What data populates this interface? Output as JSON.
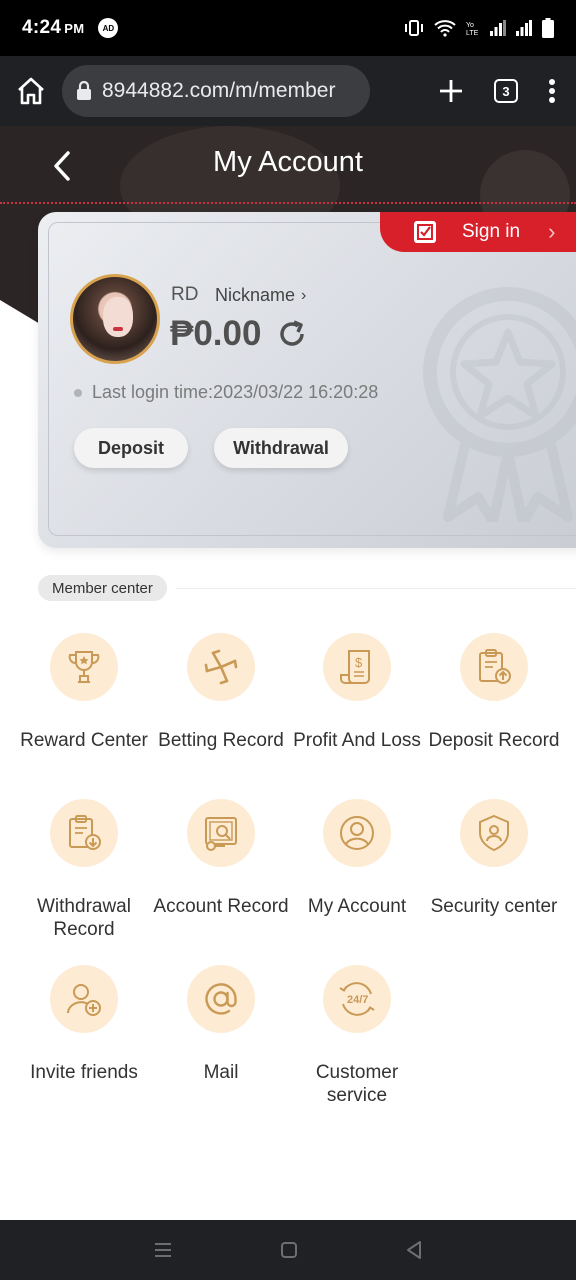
{
  "status_bar": {
    "time": "4:24",
    "ampm": "PM",
    "ad_badge": "AD"
  },
  "browser": {
    "url": "8944882.com/m/member",
    "tab_count": "3"
  },
  "header": {
    "title": "My Account"
  },
  "card": {
    "signin_label": "Sign in",
    "username": "RD",
    "nickname_label": "Nickname",
    "balance": "₱0.00",
    "last_login": "Last login time:2023/03/22 16:20:28",
    "deposit_label": "Deposit",
    "withdrawal_label": "Withdrawal"
  },
  "member_center": {
    "section_title": "Member center",
    "items": [
      {
        "label": "Reward Center",
        "icon": "trophy-icon"
      },
      {
        "label": "Betting Record",
        "icon": "pinwheel-icon"
      },
      {
        "label": "Profit And Loss",
        "icon": "bill-icon"
      },
      {
        "label": "Deposit Record",
        "icon": "clipboard-upload-icon"
      },
      {
        "label": "Withdrawal Record",
        "icon": "clipboard-download-icon"
      },
      {
        "label": "Account Record",
        "icon": "account-record-icon"
      },
      {
        "label": "My Account",
        "icon": "user-icon"
      },
      {
        "label": "Security center",
        "icon": "shield-user-icon"
      },
      {
        "label": "Invite friends",
        "icon": "add-user-icon"
      },
      {
        "label": "Mail",
        "icon": "at-icon"
      },
      {
        "label": "Customer service",
        "icon": "support-24-7-icon"
      }
    ]
  },
  "colors": {
    "accent_red": "#d8202b",
    "header_bg": "#2b2625",
    "icon_bg": "#fdebd4",
    "icon_stroke": "#c99a55"
  }
}
